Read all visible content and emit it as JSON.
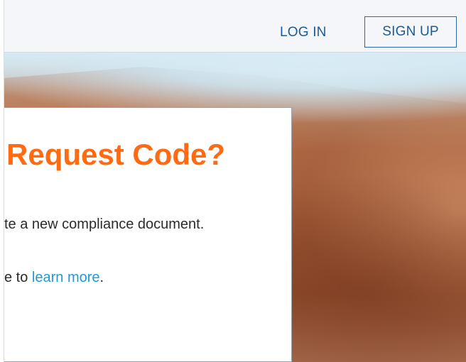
{
  "header": {
    "login_label": "LOG IN",
    "signup_label": "SIGN UP"
  },
  "modal": {
    "title": "Request Code?",
    "line1": "te a new compliance document.",
    "line2_prefix": "e to ",
    "learn_more_link": "learn more",
    "line2_suffix": "."
  },
  "colors": {
    "accent_orange": "#ff6a13",
    "link_blue": "#1f9ad6",
    "nav_blue": "#1a5b9a"
  }
}
